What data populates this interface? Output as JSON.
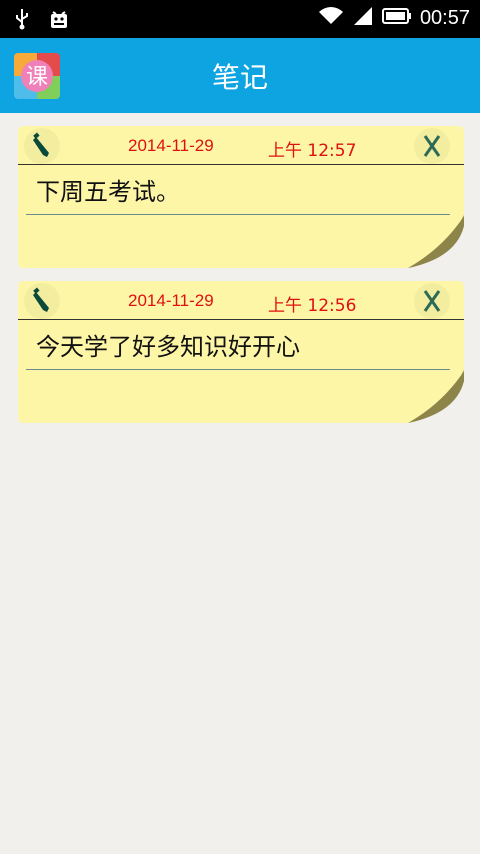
{
  "statusbar": {
    "time": "00:57"
  },
  "appbar": {
    "title": "笔记",
    "logo_char": "课"
  },
  "notes": [
    {
      "date": "2014-11-29",
      "time": "上午 12:57",
      "content": "下周五考试。"
    },
    {
      "date": "2014-11-29",
      "time": "上午 12:56",
      "content": " 今天学了好多知识好开心"
    }
  ],
  "colors": {
    "appbar": "#0ea4e2",
    "note_bg": "#fdf6a6",
    "datetime": "#e01010",
    "page_bg": "#f1f0ed"
  }
}
